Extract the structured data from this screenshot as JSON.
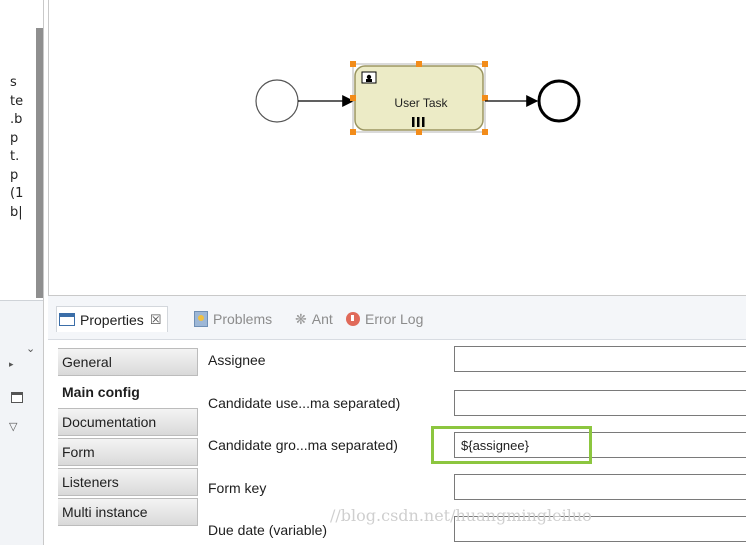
{
  "left_panel": {
    "clipped_lines": [
      "s",
      "te",
      ".b",
      "p",
      "t.",
      "p",
      "(1",
      "b|"
    ]
  },
  "diagram": {
    "user_task_label": "User Task",
    "colors": {
      "task_fill": "#ecebc6",
      "task_stroke": "#9b9661",
      "handle": "#f28c1a",
      "selection": "#b5b5b5"
    }
  },
  "properties_view": {
    "tabs": {
      "properties": "Properties",
      "problems": "Problems",
      "ant": "Ant",
      "error_log": "Error Log"
    },
    "close_glyph": "☒",
    "sections": [
      "General",
      "Main config",
      "Documentation",
      "Form",
      "Listeners",
      "Multi instance"
    ],
    "active_section": "Main config",
    "fields": {
      "assignee": {
        "label": "Assignee",
        "value": ""
      },
      "candidate_users": {
        "label": "Candidate use...ma separated)",
        "value": ""
      },
      "candidate_groups": {
        "label": "Candidate gro...ma separated)",
        "value": "${assignee}"
      },
      "form_key": {
        "label": "Form key",
        "value": ""
      },
      "due_date": {
        "label": "Due date (variable)",
        "value": ""
      }
    },
    "highlight_color": "#8cc63f"
  },
  "watermark": "//blog.csdn.net/huangmingleiluo"
}
